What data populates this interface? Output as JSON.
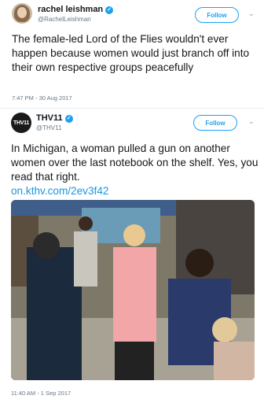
{
  "tweet_outer": {
    "display_name": "rachel leishman",
    "handle": "@RachelLeishman",
    "follow_label": "Follow",
    "text": "The female-led Lord of the Flies wouldn't ever happen because women would just branch off into their own respective groups peacefully",
    "timestamp": "7:47 PM - 30 Aug 2017",
    "menu_icon": "chevron-down-icon"
  },
  "tweet_inner": {
    "display_name": "THV11",
    "handle": "@THV11",
    "avatar_text": "THV11",
    "follow_label": "Follow",
    "text": "In Michigan, a woman pulled a gun on another women over the last notebook on the shelf. Yes, you read that right.",
    "link": "on.kthv.com/2ev3f42",
    "timestamp": "11:40 AM - 1 Sep 2017",
    "menu_icon": "chevron-down-icon",
    "photo": "store aisle photo"
  },
  "colors": {
    "accent": "#1da1f2",
    "link": "#1b95e0",
    "text": "#14171a",
    "muted": "#657786"
  }
}
